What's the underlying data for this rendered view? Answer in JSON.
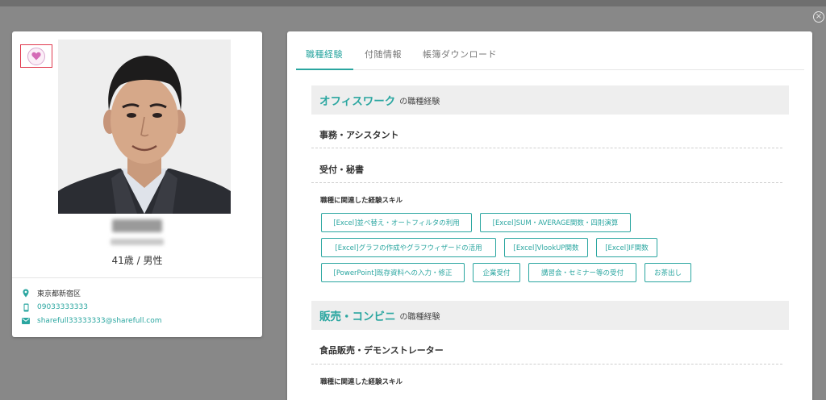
{
  "colors": {
    "accent": "#2aa6a0",
    "favorite_border": "#e03a4e",
    "heart": "#d46ab6"
  },
  "close_icon": "×",
  "profile": {
    "age_gender": "41歳 / 男性",
    "location": "東京都新宿区",
    "phone": "09033333333",
    "email": "sharefull33333333@sharefull.com"
  },
  "tabs": [
    {
      "label": "職種経験",
      "active": true
    },
    {
      "label": "付随情報",
      "active": false
    },
    {
      "label": "帳簿ダウンロード",
      "active": false
    }
  ],
  "sections": [
    {
      "category": "オフィスワーク",
      "suffix": "の職種経験",
      "jobs": [
        "事務・アシスタント",
        "受付・秘書"
      ],
      "skills_label": "職種に関連した経験スキル",
      "skills": [
        [
          "[Excel]並べ替え・オートフィルタの利用",
          "[Excel]SUM・AVERAGE関数・四則演算"
        ],
        [
          "[Excel]グラフの作成やグラフウィザードの活用",
          "[Excel]VlookUP関数",
          "[Excel]IF関数"
        ],
        [
          "[PowerPoint]既存資料への入力・修正",
          "企業受付",
          "講習会・セミナー等の受付",
          "お茶出し"
        ]
      ]
    },
    {
      "category": "販売・コンビニ",
      "suffix": "の職種経験",
      "jobs": [
        "食品販売・デモンストレーター"
      ],
      "skills_label": "職種に関連した経験スキル"
    }
  ]
}
